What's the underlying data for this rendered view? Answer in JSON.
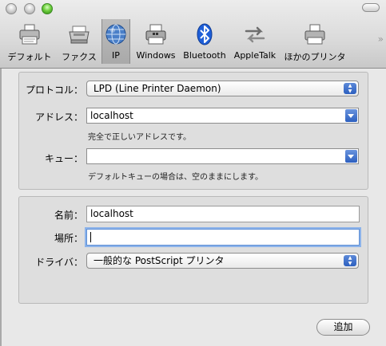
{
  "toolbar": {
    "items": [
      {
        "label": "デフォルト",
        "icon": "printer-default-icon"
      },
      {
        "label": "ファクス",
        "icon": "fax-icon"
      },
      {
        "label": "IP",
        "icon": "ip-globe-icon"
      },
      {
        "label": "Windows",
        "icon": "windows-printer-icon"
      },
      {
        "label": "Bluetooth",
        "icon": "bluetooth-icon"
      },
      {
        "label": "AppleTalk",
        "icon": "appletalk-icon"
      },
      {
        "label": "ほかのプリンタ",
        "icon": "other-printer-icon"
      }
    ],
    "selected": "IP",
    "overflow_glyph": "»"
  },
  "network": {
    "protocol_label": "プロトコル：",
    "protocol_value": "LPD (Line Printer Daemon)",
    "address_label": "アドレス：",
    "address_value": "localhost",
    "address_hint": "完全で正しいアドレスです。",
    "queue_label": "キュー：",
    "queue_value": "",
    "queue_hint": "デフォルトキューの場合は、空のままにします。"
  },
  "printer": {
    "name_label": "名前：",
    "name_value": "localhost",
    "location_label": "場所：",
    "location_value": "",
    "driver_label": "ドライバ：",
    "driver_value": "一般的な PostScript プリンタ"
  },
  "actions": {
    "add_label": "追加"
  },
  "colors": {
    "accent": "#2c5fbf",
    "bluetooth": "#1e5fd8",
    "focus_ring": "#8cb3ea"
  }
}
